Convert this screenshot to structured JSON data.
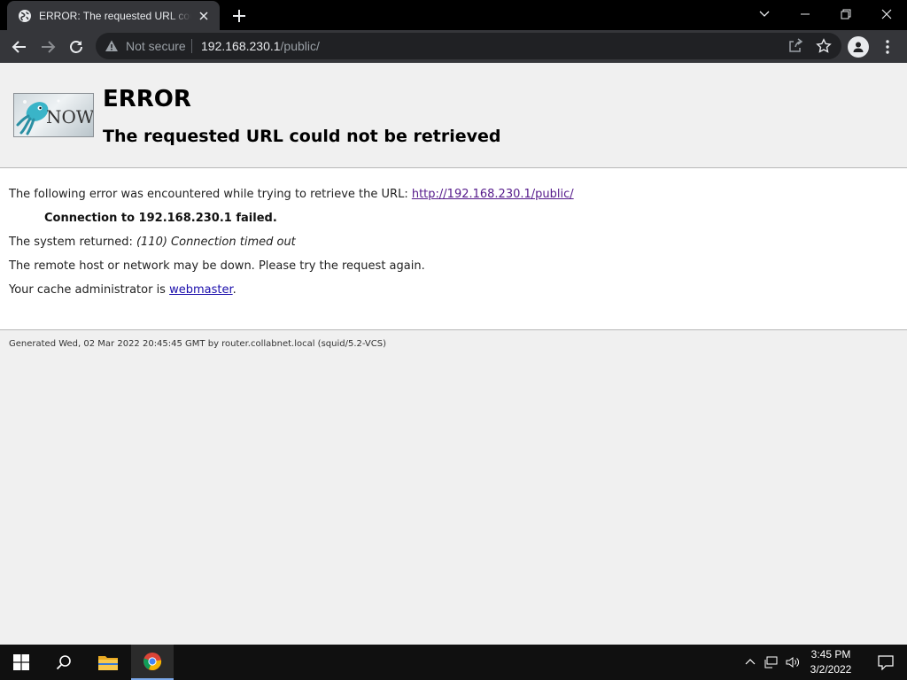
{
  "browser": {
    "tab_title": "ERROR: The requested URL could not be retrieved",
    "security_label": "Not secure",
    "url_host": "192.168.230.1",
    "url_path": "/public/"
  },
  "page": {
    "heading": "ERROR",
    "subheading": "The requested URL could not be retrieved",
    "logo_text": "NOW",
    "intro_text": "The following error was encountered while trying to retrieve the URL: ",
    "intro_link": "http://192.168.230.1/public/",
    "connection_message": "Connection to 192.168.230.1 failed.",
    "system_returned_label": "The system returned: ",
    "system_returned_value": "(110) Connection timed out",
    "remote_host_text": "The remote host or network may be down. Please try the request again.",
    "cache_admin_text": "Your cache administrator is ",
    "cache_admin_link": "webmaster",
    "cache_admin_suffix": ".",
    "footer": "Generated Wed, 02 Mar 2022 20:45:45 GMT by router.collabnet.local (squid/5.2-VCS)"
  },
  "taskbar": {
    "time": "3:45 PM",
    "date": "3/2/2022"
  },
  "icons": {
    "tab": [
      "globe-icon",
      "close-icon",
      "plus-icon"
    ],
    "window": [
      "chevron-down-icon",
      "minimize-icon",
      "restore-icon",
      "close-icon"
    ],
    "toolbar": [
      "back-icon",
      "forward-icon",
      "reload-icon",
      "warning-icon",
      "share-icon",
      "star-icon",
      "profile-icon",
      "more-icon"
    ],
    "taskbar": [
      "windows-icon",
      "search-icon",
      "file-explorer-icon",
      "chrome-icon",
      "chevron-up-icon",
      "network-icon",
      "volume-icon",
      "notification-icon"
    ]
  },
  "colors": {
    "link_visited": "#551a8b",
    "link": "#1a0dab",
    "page_bg": "#f0f0f0",
    "toolbar_bg": "#35363a"
  }
}
